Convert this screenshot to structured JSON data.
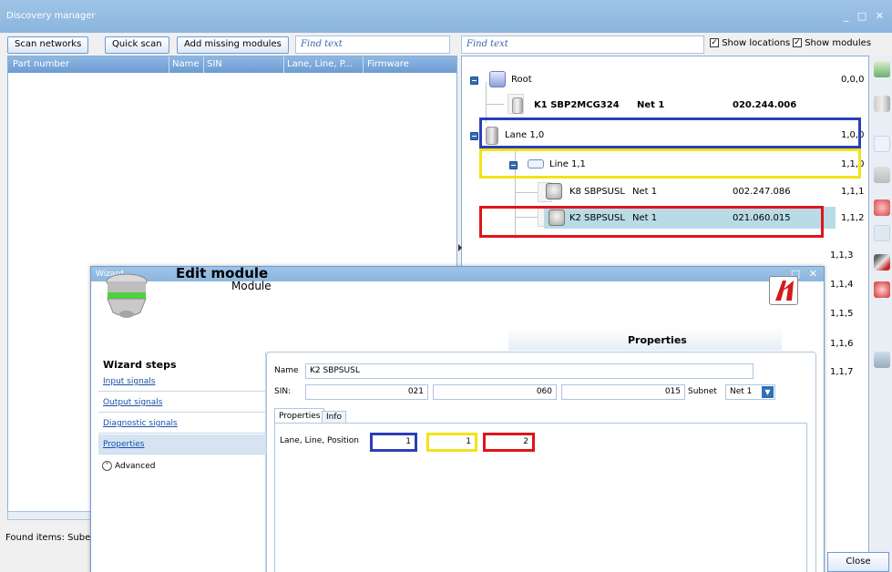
{
  "window": {
    "title": "Discovery manager",
    "controls": "_ □ ✕"
  },
  "toolbar": {
    "scan_networks": "Scan networks",
    "quick_scan": "Quick scan",
    "add_missing": "Add missing modules",
    "find_left_placeholder": "Find text",
    "find_right_placeholder": "Find text",
    "show_locations": "Show locations",
    "show_modules": "Show modules"
  },
  "left_grid": {
    "columns": [
      "Part number",
      "Name",
      "SIN",
      "Lane, Line, P...",
      "Firmware"
    ]
  },
  "status": {
    "found_items": "Found items: Sube"
  },
  "tree": {
    "root": {
      "label": "Root",
      "addr": "0,0,0"
    },
    "k1": {
      "name": "K1 SBP2MCG324",
      "net": "Net 1",
      "sin": "020.244.006"
    },
    "lane": {
      "label": "Lane 1,0",
      "addr": "1,0,0"
    },
    "line": {
      "label": "Line 1,1",
      "addr": "1,1,0"
    },
    "k8": {
      "name": "K8 SBPSUSL",
      "net": "Net 1",
      "sin": "002.247.086",
      "addr": "1,1,1"
    },
    "k2": {
      "name": "K2 SBPSUSL",
      "net": "Net 1",
      "sin": "021.060.015",
      "addr": "1,1,2"
    },
    "hidden_addrs": [
      "1,1,3",
      "1,1,4",
      "1,1,5",
      "1,1,6",
      "1,1,7"
    ]
  },
  "close_label": "Close",
  "wizard": {
    "title": "Wizard...",
    "controls": "□ ✕",
    "heading": "Edit module",
    "subheading": "Module",
    "properties_tab": "Properties",
    "steps_header": "Wizard steps",
    "steps": [
      "Input signals",
      "Output signals",
      "Diagnostic signals",
      "Properties"
    ],
    "advanced": "Advanced",
    "name_label": "Name",
    "name_value": "K2 SBPSUSL",
    "sin_label": "SIN:",
    "sin_values": [
      "021",
      "060",
      "015"
    ],
    "subnet_label": "Subnet",
    "subnet_value": "Net 1",
    "tabs": [
      "Properties",
      "Info"
    ],
    "llp_label": "Lane, Line, Position",
    "llp_values": [
      "1",
      "1",
      "2"
    ]
  },
  "colors": {
    "blue_highlight": "#2b3fb8",
    "yellow_highlight": "#f2e21a",
    "red_highlight": "#e0141b",
    "selected_row": "#b9dbe6"
  }
}
